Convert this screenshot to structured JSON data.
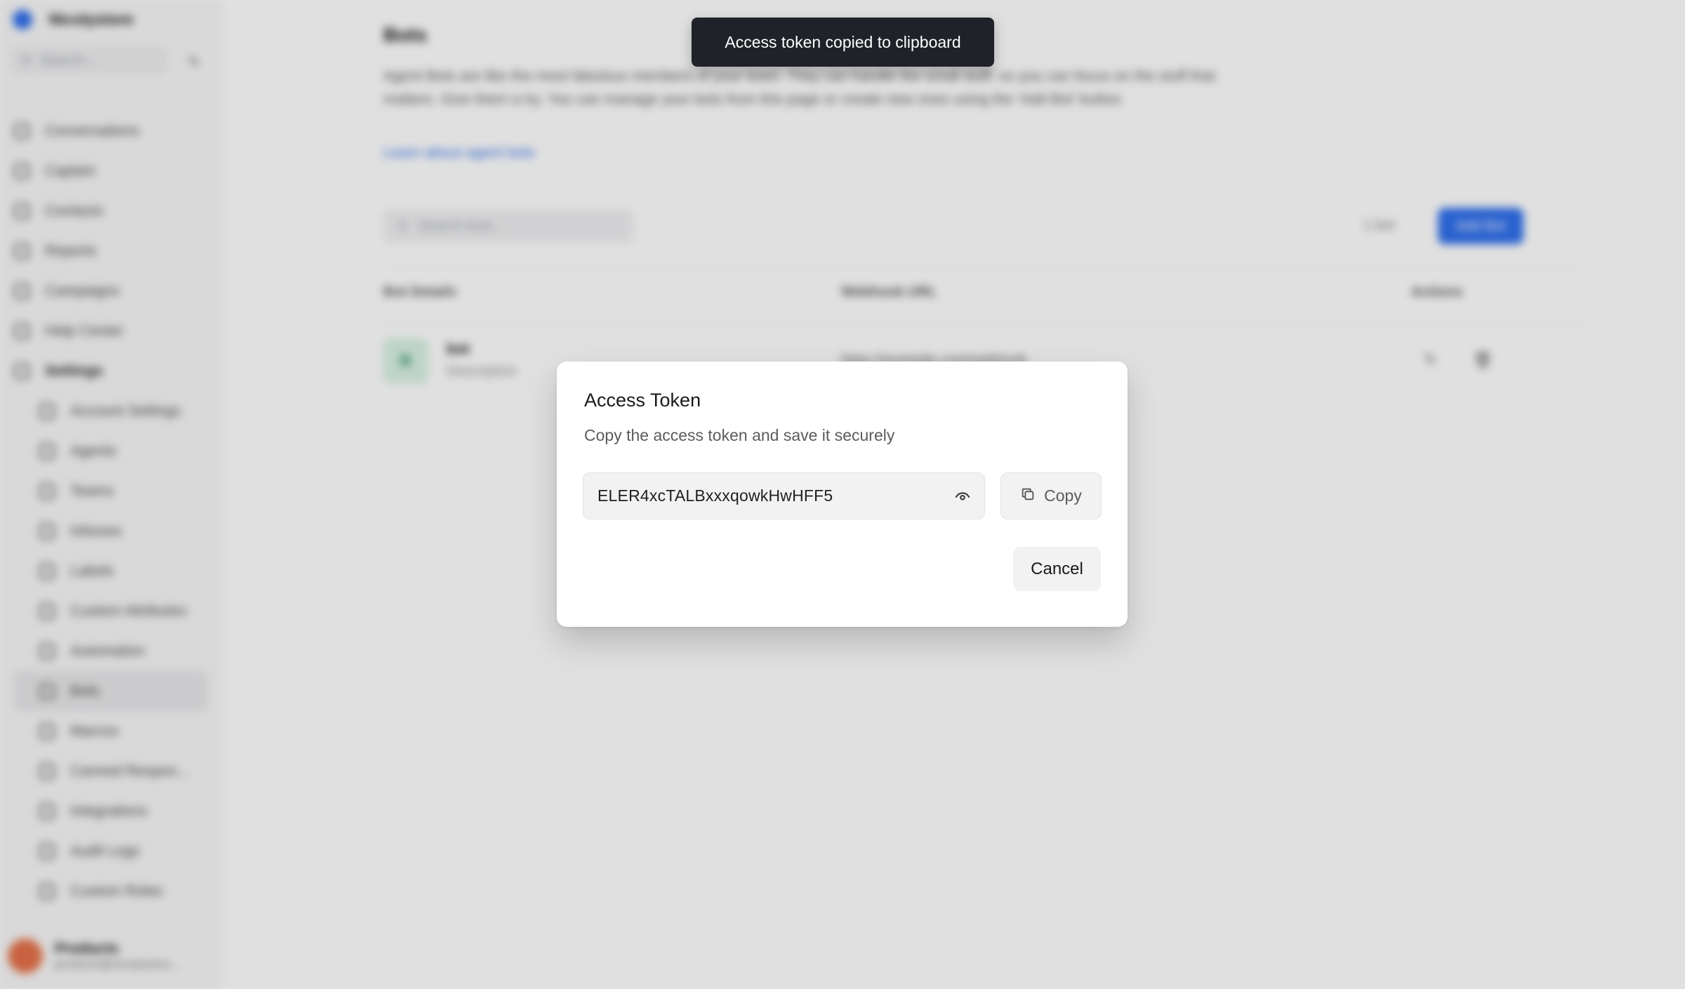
{
  "sidebar": {
    "brand": "Nicolystore",
    "search_placeholder": "Search...",
    "nav": [
      {
        "label": "Conversations"
      },
      {
        "label": "Captain"
      },
      {
        "label": "Contacts"
      },
      {
        "label": "Reports"
      },
      {
        "label": "Campaigns"
      },
      {
        "label": "Help Center"
      },
      {
        "label": "Settings"
      }
    ],
    "settings_items": [
      {
        "label": "Account Settings"
      },
      {
        "label": "Agents"
      },
      {
        "label": "Teams"
      },
      {
        "label": "Inboxes"
      },
      {
        "label": "Labels"
      },
      {
        "label": "Custom Attributes"
      },
      {
        "label": "Automation"
      },
      {
        "label": "Bots"
      },
      {
        "label": "Macros"
      },
      {
        "label": "Canned Respon..."
      },
      {
        "label": "Integrations"
      },
      {
        "label": "Audit Logs"
      },
      {
        "label": "Custom Roles"
      }
    ],
    "user": {
      "name": "Products",
      "email": "products@nicolystore..."
    }
  },
  "page": {
    "title": "Bots",
    "description": "Agent Bots are like the most fabulous members of your team. They can handle the small stuff, so you can focus on the stuff that matters. Give them a try. You can manage your bots from this page or create new ones using the 'Add Bot' button.",
    "learn_link": "Learn about agent bots",
    "search_placeholder": "Search bots...",
    "count_label": "1 bot",
    "add_button": "Add Bot",
    "table": {
      "headers": [
        "Bot Details",
        "Webhook URL",
        "Actions"
      ],
      "rows": [
        {
          "initial": "B",
          "name": "bot",
          "description": "Description",
          "webhook": "https://example.com/webhook"
        }
      ]
    }
  },
  "toast": {
    "message": "Access token copied to clipboard"
  },
  "dialog": {
    "title": "Access Token",
    "subtitle": "Copy the access token and save it securely",
    "token": "ELER4xcTALBxxxqowkHwHFF5",
    "copy_label": "Copy",
    "cancel_label": "Cancel"
  },
  "colors": {
    "accent": "#2f6fec",
    "toast_bg": "#1f2228",
    "dialog_bg": "#ffffff"
  },
  "icons": [
    "eye-icon",
    "copy-icon",
    "search-icon",
    "compose-icon"
  ]
}
